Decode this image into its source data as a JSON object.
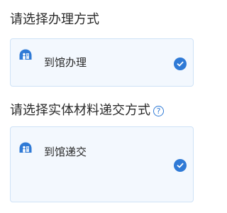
{
  "handling_method": {
    "title": "请选择办理方式",
    "option": {
      "label": "到馆办理",
      "icon": "building-person-icon",
      "selected": true
    }
  },
  "submission_method": {
    "title": "请选择实体材料递交方式",
    "help_icon": "question-circle-icon",
    "help_glyph": "?",
    "option": {
      "label": "到馆递交",
      "icon": "building-person-icon",
      "selected": true
    }
  },
  "colors": {
    "accent": "#2f7ad6",
    "card_background": "#f3f8fe",
    "card_border": "#cfe2f7"
  }
}
